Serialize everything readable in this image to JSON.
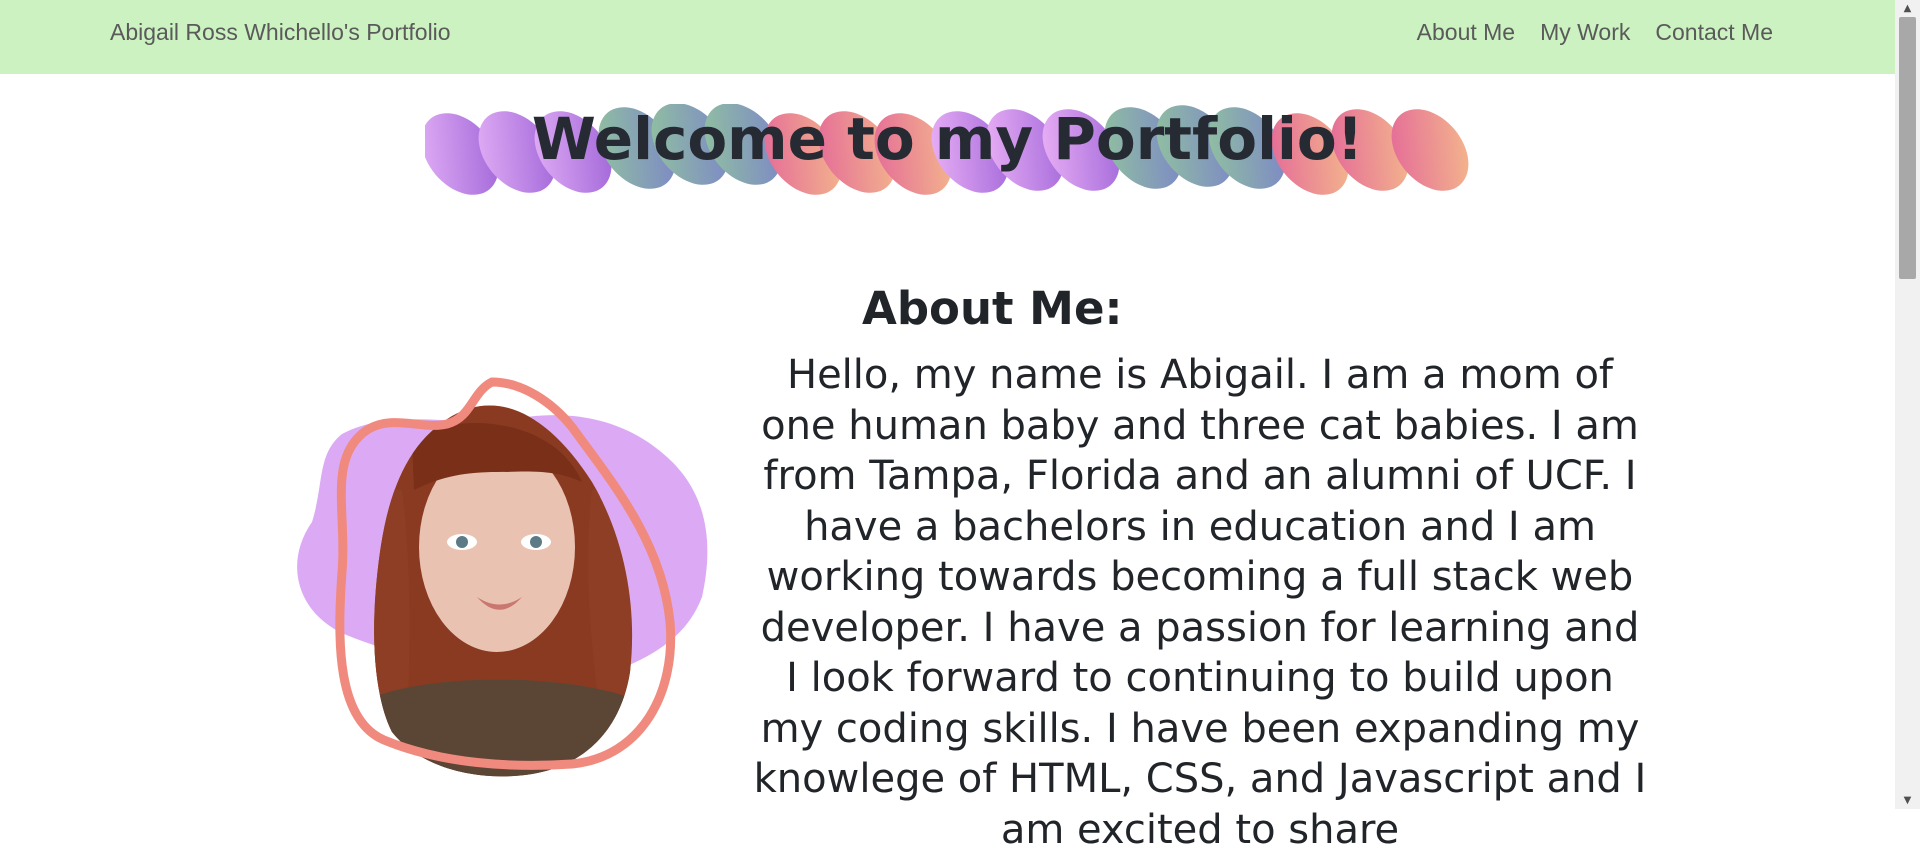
{
  "navbar": {
    "brand": "Abigail Ross Whichello's Portfolio",
    "links": [
      "About Me",
      "My Work",
      "Contact Me"
    ],
    "background": "#cbf2c0"
  },
  "main": {
    "welcome_title": "Welcome to my Portfolio!",
    "about_heading": "About Me:",
    "about_text": "Hello, my name is Abigail. I am a mom of one human baby and three cat babies. I am from Tampa, Florida and an alumni of UCF. I have a bachelors in education and I am working towards becoming a full stack web developer. I have a passion for learning and I look forward to continuing to build upon my coding skills. I have been expanding my knowlege of HTML, CSS, and Javascript and I am excited to share",
    "blob_color": "#dcaaf5",
    "ring_color": "#f08a7e"
  }
}
